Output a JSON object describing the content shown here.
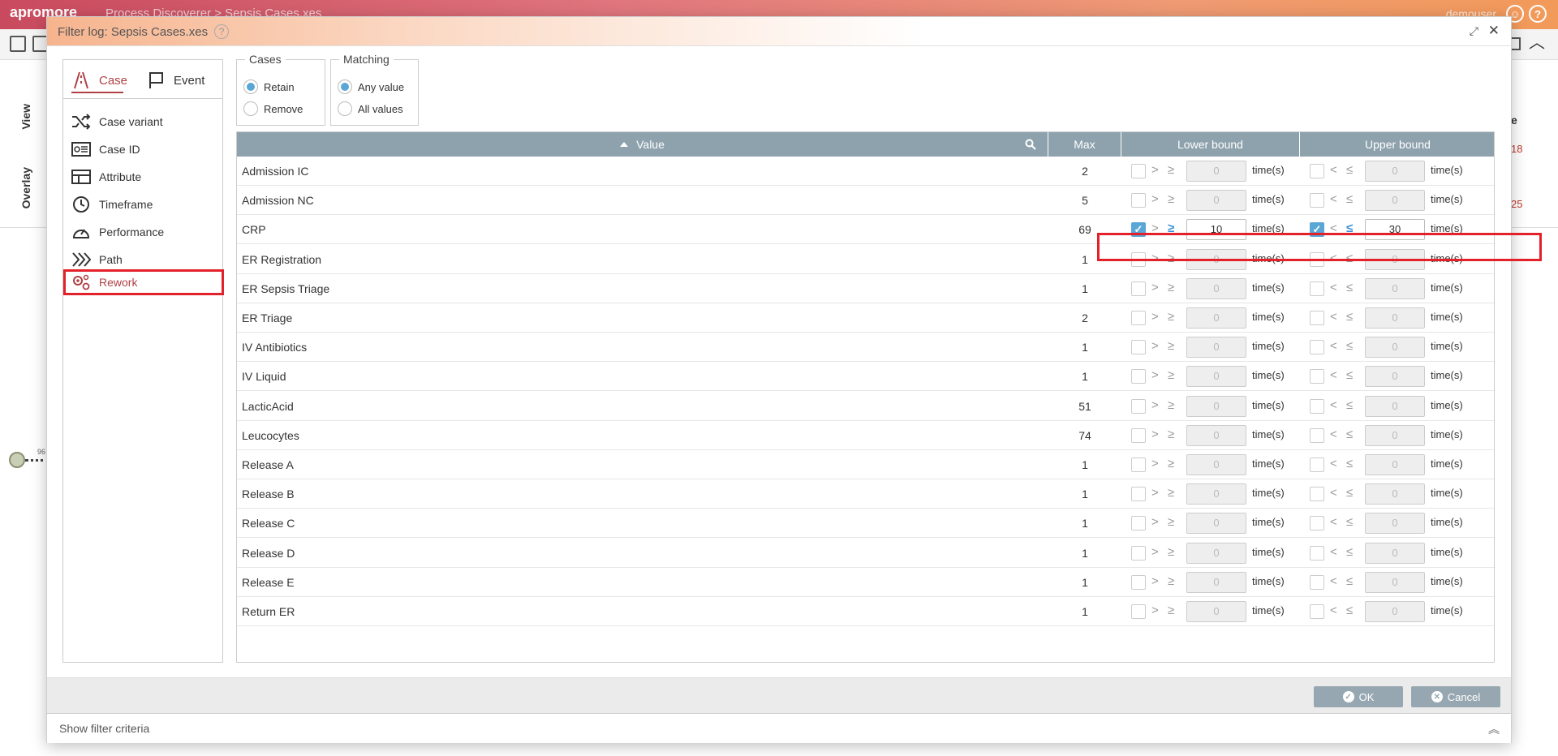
{
  "app": {
    "logo": "apromore",
    "breadcrumb": "Process Discoverer  >  Sepsis Cases.xes",
    "user": "demouser",
    "side_view": "View",
    "side_overlay": "Overlay",
    "edge_label": "96",
    "right_e": "e",
    "right_n1": "18",
    "right_n2": "25"
  },
  "dialog": {
    "title": "Filter log: Sepsis Cases.xes",
    "help": "?"
  },
  "tabs": [
    {
      "label": "Case",
      "icon": "road-icon",
      "active": true
    },
    {
      "label": "Event",
      "icon": "flag-icon",
      "active": false
    }
  ],
  "nav": [
    {
      "label": "Case variant",
      "icon": "shuffle-icon"
    },
    {
      "label": "Case ID",
      "icon": "id-card-icon"
    },
    {
      "label": "Attribute",
      "icon": "table-icon"
    },
    {
      "label": "Timeframe",
      "icon": "clock-icon"
    },
    {
      "label": "Performance",
      "icon": "gauge-icon"
    },
    {
      "label": "Path",
      "icon": "chevrons-icon"
    },
    {
      "label": "Rework",
      "icon": "gears-icon",
      "active": true
    }
  ],
  "cases": {
    "legend": "Cases",
    "options": [
      "Retain",
      "Remove"
    ],
    "selected": "Retain"
  },
  "matching": {
    "legend": "Matching",
    "options": [
      "Any value",
      "All values"
    ],
    "selected": "Any value"
  },
  "table": {
    "headers": {
      "value": "Value",
      "max": "Max",
      "lower": "Lower bound",
      "upper": "Upper bound"
    },
    "gt": ">",
    "ge": "≥",
    "lt": "<",
    "le": "≤",
    "unit": "time(s)",
    "rows": [
      {
        "value": "Admission IC",
        "max": "2",
        "lower_on": false,
        "lower": "0",
        "upper_on": false,
        "upper": "0"
      },
      {
        "value": "Admission NC",
        "max": "5",
        "lower_on": false,
        "lower": "0",
        "upper_on": false,
        "upper": "0"
      },
      {
        "value": "CRP",
        "max": "69",
        "lower_on": true,
        "lower": "10",
        "upper_on": true,
        "upper": "30"
      },
      {
        "value": "ER Registration",
        "max": "1",
        "lower_on": false,
        "lower": "0",
        "upper_on": false,
        "upper": "0"
      },
      {
        "value": "ER Sepsis Triage",
        "max": "1",
        "lower_on": false,
        "lower": "0",
        "upper_on": false,
        "upper": "0"
      },
      {
        "value": "ER Triage",
        "max": "2",
        "lower_on": false,
        "lower": "0",
        "upper_on": false,
        "upper": "0"
      },
      {
        "value": "IV Antibiotics",
        "max": "1",
        "lower_on": false,
        "lower": "0",
        "upper_on": false,
        "upper": "0"
      },
      {
        "value": "IV Liquid",
        "max": "1",
        "lower_on": false,
        "lower": "0",
        "upper_on": false,
        "upper": "0"
      },
      {
        "value": "LacticAcid",
        "max": "51",
        "lower_on": false,
        "lower": "0",
        "upper_on": false,
        "upper": "0"
      },
      {
        "value": "Leucocytes",
        "max": "74",
        "lower_on": false,
        "lower": "0",
        "upper_on": false,
        "upper": "0"
      },
      {
        "value": "Release A",
        "max": "1",
        "lower_on": false,
        "lower": "0",
        "upper_on": false,
        "upper": "0"
      },
      {
        "value": "Release B",
        "max": "1",
        "lower_on": false,
        "lower": "0",
        "upper_on": false,
        "upper": "0"
      },
      {
        "value": "Release C",
        "max": "1",
        "lower_on": false,
        "lower": "0",
        "upper_on": false,
        "upper": "0"
      },
      {
        "value": "Release D",
        "max": "1",
        "lower_on": false,
        "lower": "0",
        "upper_on": false,
        "upper": "0"
      },
      {
        "value": "Release E",
        "max": "1",
        "lower_on": false,
        "lower": "0",
        "upper_on": false,
        "upper": "0"
      },
      {
        "value": "Return ER",
        "max": "1",
        "lower_on": false,
        "lower": "0",
        "upper_on": false,
        "upper": "0"
      }
    ]
  },
  "footer": {
    "ok": "OK",
    "cancel": "Cancel",
    "show_criteria": "Show filter criteria"
  },
  "colors": {
    "accent": "#b04045",
    "highlight": "#e2212a",
    "header": "#8ea2ad",
    "check": "#5aa6d6"
  }
}
